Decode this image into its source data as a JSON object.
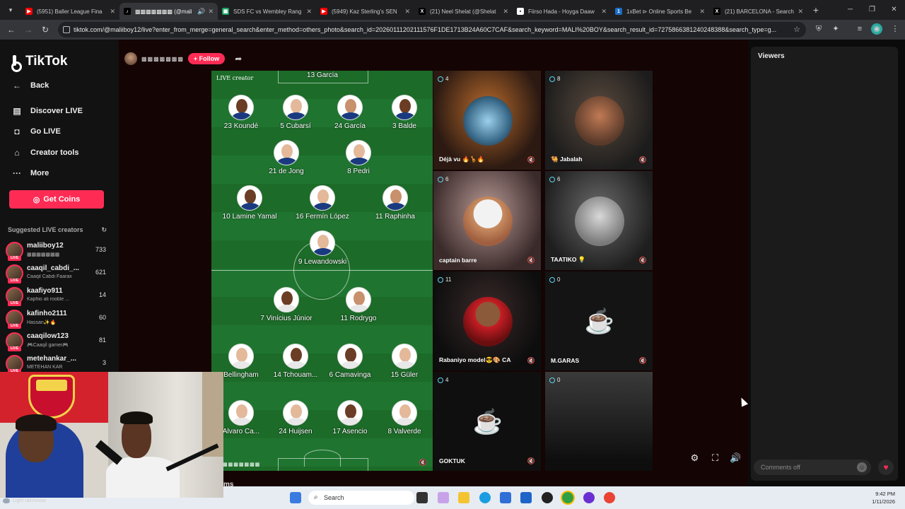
{
  "browser": {
    "tabs": [
      {
        "title": "(5951) Baller League Fina",
        "favicon_color": "#ff0000"
      },
      {
        "title": "▩▩▩▩▩▩▩ (@mali",
        "favicon_color": "#000000",
        "active": true
      },
      {
        "title": "SDS FC vs Wembley Rang",
        "favicon_color": "#1aa260"
      },
      {
        "title": "(5949) Kaz Sterling's SEN",
        "favicon_color": "#ff0000"
      },
      {
        "title": "(21) Neel Shelat (@Shelat",
        "favicon_color": "#000000"
      },
      {
        "title": "Fiirso Hada - Hoyga Daaw",
        "favicon_color": "#ffffff"
      },
      {
        "title": "1xBet ⊳ Online Sports Be",
        "favicon_color": "#1b6dc1"
      },
      {
        "title": "(21) BARCELONA - Search",
        "favicon_color": "#000000"
      }
    ],
    "new_tab": "+",
    "url": "tiktok.com/@maliiboy12/live?enter_from_merge=general_search&enter_method=others_photo&search_id=20260111202111576F1DE1713B24A60C7CAF&search_keyword=MALI%20BOY&search_result_id=7275866381240248388&search_type=g..."
  },
  "sidebar": {
    "logo": "TikTok",
    "nav": [
      {
        "label": "Back",
        "icon": "←"
      },
      {
        "label": "Discover LIVE",
        "icon": "▤"
      },
      {
        "label": "Go LIVE",
        "icon": "◘"
      },
      {
        "label": "Creator tools",
        "icon": "⌂"
      },
      {
        "label": "More",
        "icon": "···"
      }
    ],
    "get_coins": "Get Coins",
    "suggested_title": "Suggested LIVE creators",
    "creators": [
      {
        "name": "maliiboy12",
        "sub": "▩▩▩▩▩▩▩",
        "count": "733"
      },
      {
        "name": "caaqil_cabdi_...",
        "sub": "Caaqil Cabdi Faarax",
        "count": "621"
      },
      {
        "name": "kaafiyo911",
        "sub": "Kaphio ali rooble ...",
        "count": "14"
      },
      {
        "name": "kafinho2111",
        "sub": "Hassan✨🔥",
        "count": "60"
      },
      {
        "name": "caaqilow123",
        "sub": "🎮Caaqil gamer🎮",
        "count": "81"
      },
      {
        "name": "metehankar_...",
        "sub": "METEHAN KAR",
        "count": "3"
      }
    ],
    "live_badge": "LIVE"
  },
  "live": {
    "host_name": "▩▩▩▩▩▩▩",
    "follow_label": "+ Follow",
    "pitch": {
      "label": "LIVE creator",
      "bottom_tag": "▩▩▩▩▩▩▩",
      "players": [
        {
          "name": "13 García"
        },
        {
          "name": "23 Koundé"
        },
        {
          "name": "5 Cubarsí"
        },
        {
          "name": "24 García"
        },
        {
          "name": "3 Balde"
        },
        {
          "name": "21 de Jong"
        },
        {
          "name": "8 Pedri"
        },
        {
          "name": "10 Lamine Yamal"
        },
        {
          "name": "16 Fermín López"
        },
        {
          "name": "11 Raphinha"
        },
        {
          "name": "9 Lewandowski"
        },
        {
          "name": "7 Vinícius Júnior"
        },
        {
          "name": "11 Rodrygo"
        },
        {
          "name": "Bellingham"
        },
        {
          "name": "14 Tchouam..."
        },
        {
          "name": "6 Camavinga"
        },
        {
          "name": "15 Güler"
        },
        {
          "name": "Alvaro Ca..."
        },
        {
          "name": "24 Huijsen"
        },
        {
          "name": "17 Asencio"
        },
        {
          "name": "8 Valverde"
        }
      ]
    },
    "guests": [
      {
        "name": "Déjà vu 🔥🦒🔥",
        "viewers": "4"
      },
      {
        "name": "🐫 Jabalah",
        "viewers": "8"
      },
      {
        "name": "captain barre",
        "viewers": "6"
      },
      {
        "name": "TAATIKO 💡",
        "viewers": "6"
      },
      {
        "name": "Rabaniyo model😎🎨 CA",
        "viewers": "11"
      },
      {
        "name": "M.GARAS",
        "viewers": "0"
      },
      {
        "name": "GOKTUK",
        "viewers": "4"
      },
      {
        "name": "",
        "viewers": "0"
      }
    ]
  },
  "viewers_panel": {
    "title": "Viewers",
    "comments_placeholder": "Comments off"
  },
  "overlay": {
    "weather": "Light rain/snow",
    "partial_text": "ms"
  },
  "taskbar": {
    "search": "Search",
    "time": "9:42 PM",
    "date": "1/11/2026"
  }
}
